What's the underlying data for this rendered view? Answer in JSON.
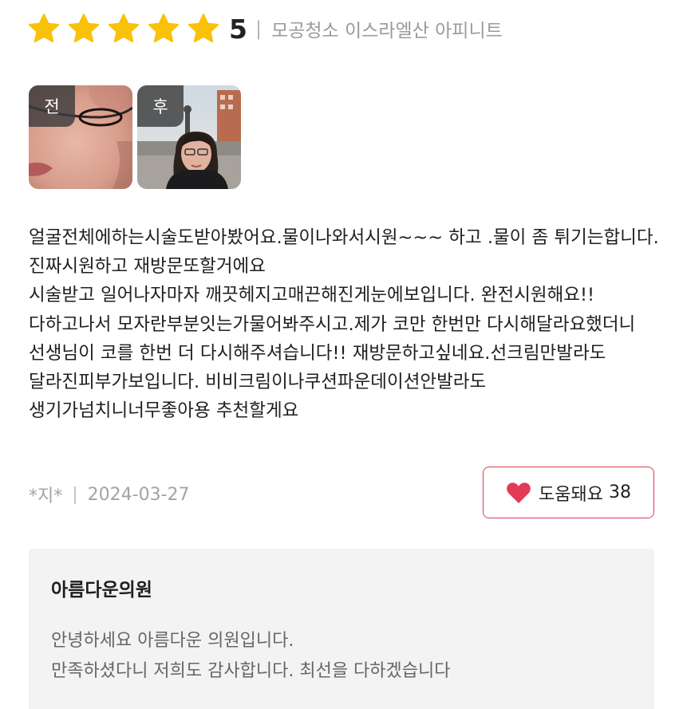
{
  "review": {
    "rating": {
      "stars": 5,
      "score": "5",
      "separator": "|",
      "product": "모공청소 이스라엘산 아피니트",
      "star_color": "#f9c20a",
      "star_icon": "star-icon"
    },
    "photos": {
      "before_tag": "전",
      "after_tag": "후"
    },
    "body": "얼굴전체에하는시술도받아봤어요.물이나와서시원~~~ 하고 .물이 좀 튀기는합니다.진짜시원하고 재방문또할거에요\n시술받고 일어나자마자 깨끗헤지고매끈해진게눈에보입니다. 완전시원해요!! 다하고나서 모자란부분잇는가물어봐주시고.제가 코만 한번만 다시해달라요했더니 선생님이 코를 한번 더 다시해주셔습니다!! 재방문하고싶네요.선크림만발라도 달라진피부가보입니다. 비비크림이나쿠션파운데이션안발라도 생기가넘치니너무좋아용 추천할게요",
    "author": "*지*",
    "meta_separator": "|",
    "date": "2024-03-27",
    "helpful": {
      "label": "도움돼요",
      "count": "38",
      "icon": "heart-icon",
      "accent_color": "#e23b55"
    }
  },
  "reply": {
    "author": "아름다운의원",
    "text": "안녕하세요 아름다운 의원입니다.\n만족하셨다니 저희도 감사합니다. 최선을 다하겠습니다",
    "background_color": "#f3f3f3"
  }
}
